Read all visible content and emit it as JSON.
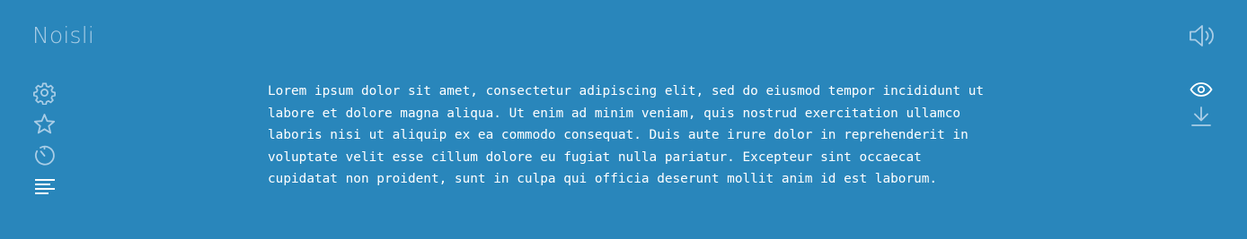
{
  "app": {
    "logo_text": "Noisli",
    "accent_color": "#2986bb"
  },
  "left_nav": {
    "items": [
      {
        "name": "settings",
        "icon": "gear-icon",
        "active": false
      },
      {
        "name": "favorites",
        "icon": "star-icon",
        "active": false
      },
      {
        "name": "timer",
        "icon": "timer-icon",
        "active": false
      },
      {
        "name": "text-editor",
        "icon": "text-lines-icon",
        "active": true
      }
    ]
  },
  "top_right": {
    "icon": "volume-icon"
  },
  "right_tools": {
    "items": [
      {
        "name": "preview",
        "icon": "eye-icon"
      },
      {
        "name": "download",
        "icon": "download-icon"
      }
    ]
  },
  "editor": {
    "lines": [
      "Lorem ipsum dolor sit amet, consectetur adipiscing elit, sed do eiusmod tempor incididunt ut",
      "labore et dolore magna aliqua. Ut enim ad minim veniam, quis nostrud exercitation ullamco",
      "laboris nisi ut aliquip ex ea commodo consequat. Duis aute irure dolor in reprehenderit in",
      "voluptate velit esse cillum dolore eu fugiat nulla pariatur. Excepteur sint occaecat",
      "cupidatat non proident, sunt in culpa qui officia deserunt mollit anim id est laborum."
    ]
  }
}
